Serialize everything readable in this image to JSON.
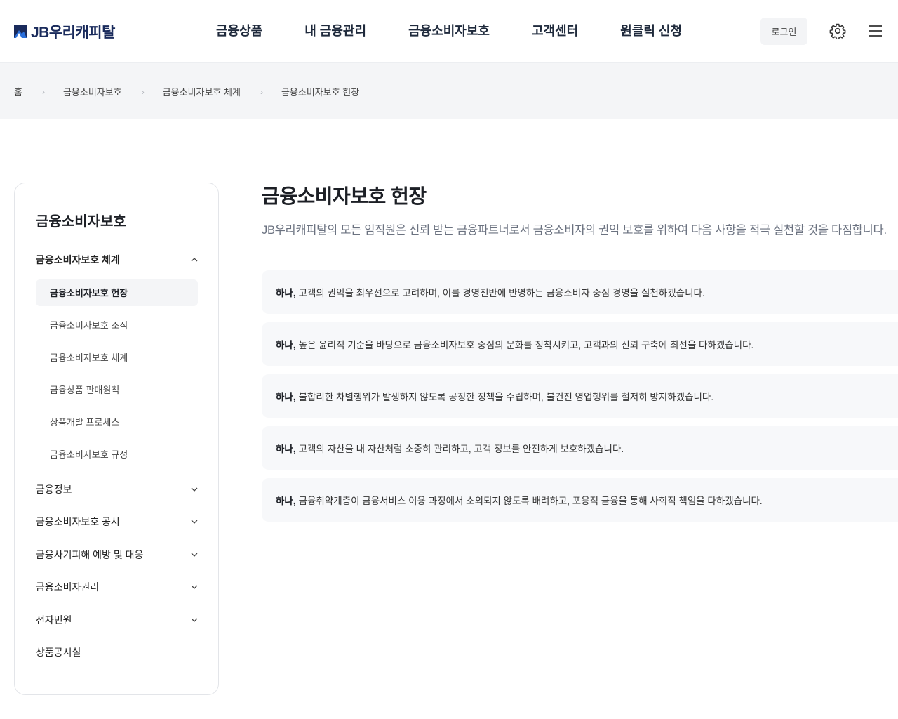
{
  "header": {
    "logo_text": "JB우리캐피탈",
    "nav": [
      "금융상품",
      "내 금융관리",
      "금융소비자보호",
      "고객센터",
      "원클릭 신청"
    ],
    "login_label": "로그인"
  },
  "breadcrumb": [
    "홈",
    "금융소비자보호",
    "금융소비자보호 체계",
    "금융소비자보호 헌장"
  ],
  "sidebar": {
    "title": "금융소비자보호",
    "open_group": "금융소비자보호 체계",
    "sub_items": [
      "금융소비자보호 헌장",
      "금융소비자보호 조직",
      "금융소비자보호 체계",
      "금융상품 판매원칙",
      "상품개발 프로세스",
      "금융소비자보호 규정"
    ],
    "groups": [
      "금융정보",
      "금융소비자보호 공시",
      "금융사기피해 예방 및 대응",
      "금융소비자권리",
      "전자민원",
      "상품공시실"
    ]
  },
  "main": {
    "title": "금융소비자보호 헌장",
    "description": "JB우리캐피탈의 모든 임직원은 신뢰 받는 금융파트너로서 금융소비자의 권익 보호를 위하여 다음 사항을 적극 실천할 것을 다짐합니다.",
    "pledge_lead": "하나,",
    "pledges": [
      "고객의 권익을 최우선으로 고려하며, 이를 경영전반에 반영하는 금융소비자 중심 경영을 실천하겠습니다.",
      "높은 윤리적 기준을 바탕으로 금융소비자보호 중심의 문화를 정착시키고, 고객과의 신뢰 구축에 최선을 다하겠습니다.",
      "불합리한 차별행위가 발생하지 않도록 공정한 정책을 수립하며, 불건전 영업행위를 철저히 방지하겠습니다.",
      "고객의 자산을 내 자산처럼 소중히 관리하고, 고객 정보를 안전하게 보호하겠습니다.",
      "금융취약계층이 금융서비스 이용 과정에서 소외되지 않도록 배려하고, 포용적 금융을 통해 사회적 책임을 다하겠습니다."
    ]
  },
  "colors": {
    "brand_navy": "#1a2b5c",
    "brand_blue": "#2a6fdb",
    "panel_gray": "#f4f5f7"
  },
  "icons": [
    "jb-logo-mark",
    "settings-gear-icon",
    "hamburger-menu-icon",
    "chevron-up-icon",
    "chevron-down-icon",
    "breadcrumb-chevron-icon"
  ]
}
